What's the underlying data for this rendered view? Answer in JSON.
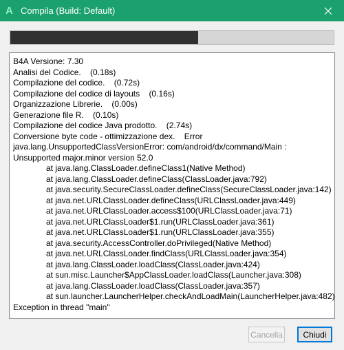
{
  "window": {
    "title": "Compila (Build: Default)",
    "app_icon_glyph": "A",
    "accent_color": "#1aa16e"
  },
  "progress": {
    "fraction": 0.58
  },
  "log": {
    "lines": [
      {
        "text": "B4A Versione: 7.30",
        "indent": false
      },
      {
        "text": "Analisi del Codice.    (0.18s)",
        "indent": false
      },
      {
        "text": "Compilazione del codice.    (0.72s)",
        "indent": false
      },
      {
        "text": "Compilazione del codice di layouts    (0.16s)",
        "indent": false
      },
      {
        "text": "Organizzazione Librerie.    (0.00s)",
        "indent": false
      },
      {
        "text": "Generazione file R.    (0.10s)",
        "indent": false
      },
      {
        "text": "Compilazione del codice Java prodotto.    (2.74s)",
        "indent": false
      },
      {
        "text": "Conversione byte code - ottimizzazione dex.    Error",
        "indent": false
      },
      {
        "text": "java.lang.UnsupportedClassVersionError: com/android/dx/command/Main :",
        "indent": false
      },
      {
        "text": "Unsupported major.minor version 52.0",
        "indent": false
      },
      {
        "text": "at java.lang.ClassLoader.defineClass1(Native Method)",
        "indent": true
      },
      {
        "text": "at java.lang.ClassLoader.defineClass(ClassLoader.java:792)",
        "indent": true
      },
      {
        "text": "at java.security.SecureClassLoader.defineClass(SecureClassLoader.java:142)",
        "indent": true
      },
      {
        "text": "at java.net.URLClassLoader.defineClass(URLClassLoader.java:449)",
        "indent": true
      },
      {
        "text": "at java.net.URLClassLoader.access$100(URLClassLoader.java:71)",
        "indent": true
      },
      {
        "text": "at java.net.URLClassLoader$1.run(URLClassLoader.java:361)",
        "indent": true
      },
      {
        "text": "at java.net.URLClassLoader$1.run(URLClassLoader.java:355)",
        "indent": true
      },
      {
        "text": "at java.security.AccessController.doPrivileged(Native Method)",
        "indent": true
      },
      {
        "text": "at java.net.URLClassLoader.findClass(URLClassLoader.java:354)",
        "indent": true
      },
      {
        "text": "at java.lang.ClassLoader.loadClass(ClassLoader.java:424)",
        "indent": true
      },
      {
        "text": "at sun.misc.Launcher$AppClassLoader.loadClass(Launcher.java:308)",
        "indent": true
      },
      {
        "text": "at java.lang.ClassLoader.loadClass(ClassLoader.java:357)",
        "indent": true
      },
      {
        "text": "at sun.launcher.LauncherHelper.checkAndLoadMain(LauncherHelper.java:482)",
        "indent": true
      },
      {
        "text": "Exception in thread \"main\"",
        "indent": false
      }
    ]
  },
  "buttons": {
    "cancel_label": "Cancella",
    "close_label": "Chiudi"
  },
  "icons": {
    "close": "close-icon",
    "app": "app-icon"
  }
}
